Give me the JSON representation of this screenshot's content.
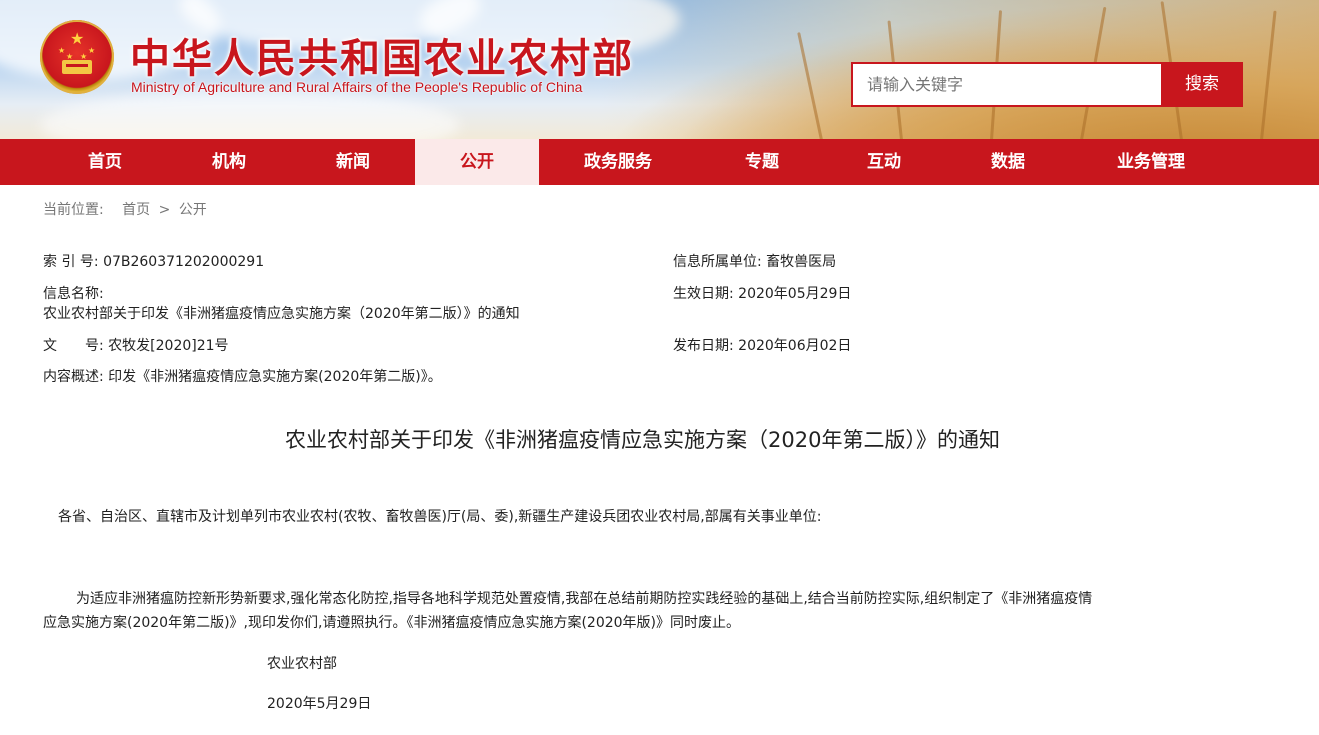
{
  "header": {
    "site_title": "中华人民共和国农业农村部",
    "site_subtitle": "Ministry of Agriculture and Rural Affairs of the People's Republic of China",
    "search_placeholder": "请输入关键字",
    "search_button": "搜索"
  },
  "nav": {
    "items": [
      {
        "label": "首页",
        "active": false
      },
      {
        "label": "机构",
        "active": false
      },
      {
        "label": "新闻",
        "active": false
      },
      {
        "label": "公开",
        "active": true
      },
      {
        "label": "政务服务",
        "active": false
      },
      {
        "label": "专题",
        "active": false
      },
      {
        "label": "互动",
        "active": false
      },
      {
        "label": "数据",
        "active": false
      },
      {
        "label": "业务管理",
        "active": false
      }
    ]
  },
  "breadcrumb": {
    "prefix": "当前位置:",
    "home": "首页",
    "separator": ">",
    "current": "公开"
  },
  "meta": {
    "index_label": "索 引 号:",
    "index_value": "07B260371202000291",
    "org_label": "信息所属单位:",
    "org_value": "畜牧兽医局",
    "name_label": "信息名称:",
    "name_value": "农业农村部关于印发《非洲猪瘟疫情应急实施方案（2020年第二版）》的通知",
    "effective_label": "生效日期:",
    "effective_value": "2020年05月29日",
    "doc_no_label": "文　　号:",
    "doc_no_value": "农牧发[2020]21号",
    "publish_label": "发布日期:",
    "publish_value": "2020年06月02日",
    "summary_label": "内容概述:",
    "summary_value": "印发《非洲猪瘟疫情应急实施方案(2020年第二版)》。"
  },
  "article": {
    "title": "农业农村部关于印发《非洲猪瘟疫情应急实施方案（2020年第二版）》的通知",
    "salutation": "各省、自治区、直辖市及计划单列市农业农村(农牧、畜牧兽医)厅(局、委),新疆生产建设兵团农业农村局,部属有关事业单位:",
    "body_line1": "为适应非洲猪瘟防控新形势新要求,强化常态化防控,指导各地科学规范处置疫情,我部在总结前期防控实践经验的基础上,结合当前防控实际,组织制定了《非洲猪瘟疫情",
    "body_line2": "应急实施方案(2020年第二版)》,现印发你们,请遵照执行。《非洲猪瘟疫情应急实施方案(2020年版)》同时废止。",
    "signature": "农业农村部",
    "date": "2020年5月29日"
  },
  "colors": {
    "brand_red": "#c8161d",
    "nav_active_bg": "#fbe9e9"
  }
}
